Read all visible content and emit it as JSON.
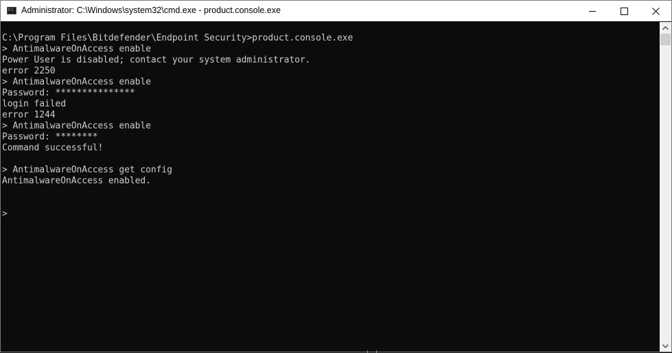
{
  "window": {
    "title": "Administrator: C:\\Windows\\system32\\cmd.exe - product.console.exe",
    "icon": "cmd-icon",
    "icon_label": "C:\\",
    "controls": {
      "minimize": "minimize-icon",
      "maximize": "maximize-icon",
      "close": "close-icon"
    }
  },
  "console": {
    "lines": [
      "C:\\Program Files\\Bitdefender\\Endpoint Security>product.console.exe",
      "> AntimalwareOnAccess enable",
      "Power User is disabled; contact your system administrator.",
      "error 2250",
      "> AntimalwareOnAccess enable",
      "Password: ***************",
      "login failed",
      "error 1244",
      "> AntimalwareOnAccess enable",
      "Password: ********",
      "Command successful!",
      "",
      "> AntimalwareOnAccess get config",
      "AntimalwareOnAccess enabled.",
      "",
      "",
      ">"
    ]
  },
  "colors": {
    "console_bg": "#0c0c0c",
    "console_fg": "#cccccc",
    "titlebar_bg": "#ffffff"
  }
}
